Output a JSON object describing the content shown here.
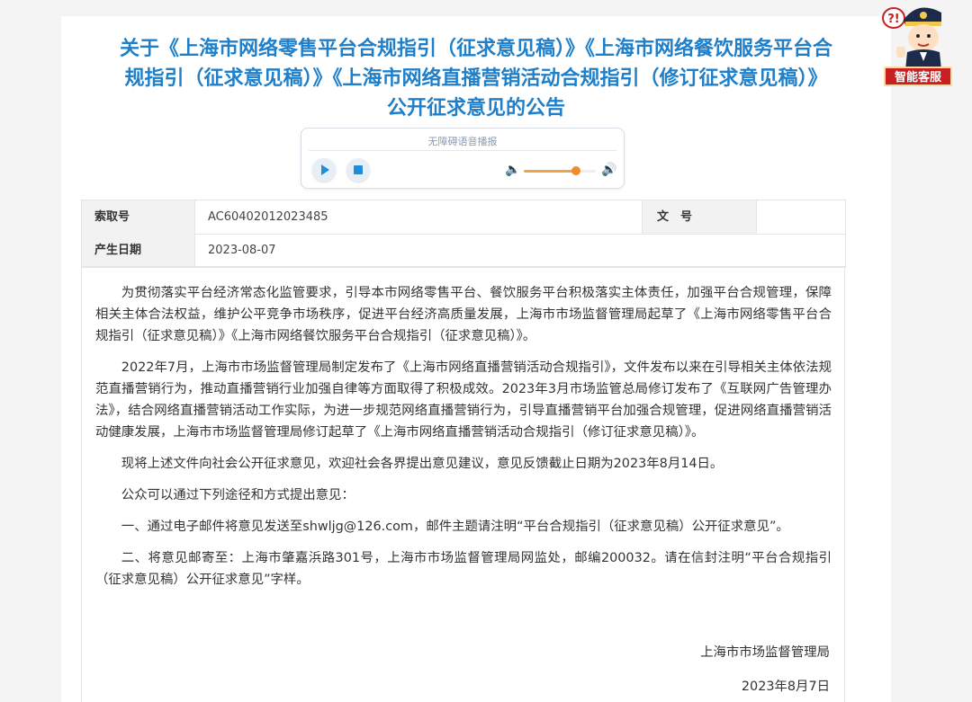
{
  "header": {
    "title_line1": "关于《上海市网络零售平台合规指引（征求意见稿）》《上海市网络餐饮服务平台合",
    "title_line2": "规指引（征求意见稿）》《上海市网络直播营销活动合规指引（修订征求意见稿）》",
    "title_line3": "公开征求意见的公告"
  },
  "audio_player": {
    "label": "无障碍语音播报",
    "volume_fraction": 0.72
  },
  "assistant": {
    "badge_label": "智能客服",
    "bubble_text": "?!"
  },
  "meta": {
    "index_label": "索取号",
    "index_value": "AC60402012023485",
    "doc_no_label": "文　号",
    "doc_no_value": "",
    "date_label": "产生日期",
    "date_value": "2023-08-07"
  },
  "content": {
    "paragraphs": [
      "为贯彻落实平台经济常态化监管要求，引导本市网络零售平台、餐饮服务平台积极落实主体责任，加强平台合规管理，保障相关主体合法权益，维护公平竞争市场秩序，促进平台经济高质量发展，上海市市场监督管理局起草了《上海市网络零售平台合规指引（征求意见稿）》《上海市网络餐饮服务平台合规指引（征求意见稿）》。",
      "2022年7月，上海市市场监督管理局制定发布了《上海市网络直播营销活动合规指引》，文件发布以来在引导相关主体依法规范直播营销行为，推动直播营销行业加强自律等方面取得了积极成效。2023年3月市场监管总局修订发布了《互联网广告管理办法》，结合网络直播营销活动工作实际，为进一步规范网络直播营销行为，引导直播营销平台加强合规管理，促进网络直播营销活动健康发展，上海市市场监督管理局修订起草了《上海市网络直播营销活动合规指引（修订征求意见稿）》。",
      "现将上述文件向社会公开征求意见，欢迎社会各界提出意见建议，意见反馈截止日期为2023年8月14日。",
      "公众可以通过下列途径和方式提出意见：",
      "一、通过电子邮件将意见发送至shwljg@126.com，邮件主题请注明“平台合规指引（征求意见稿）公开征求意见”。",
      "二、将意见邮寄至：上海市肇嘉浜路301号，上海市市场监督管理局网监处，邮编200032。请在信封注明“平台合规指引（征求意见稿）公开征求意见”字样。"
    ],
    "signature_org": "上海市市场监督管理局",
    "signature_date": "2023年8月7日"
  }
}
